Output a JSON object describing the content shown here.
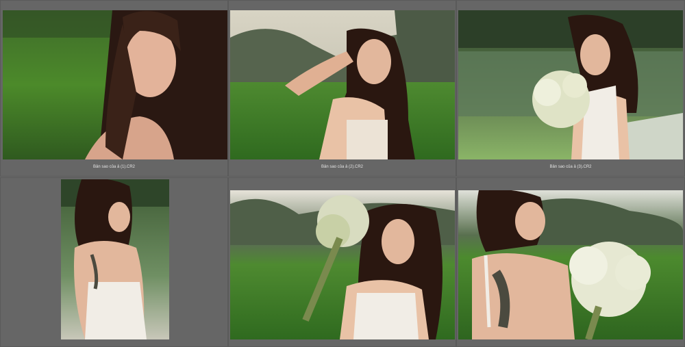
{
  "grid": {
    "captions": [
      "Bản sao của ả (1).CR2",
      "Bản sao của ả (2).CR2",
      "Bản sao của ả (3).CR2"
    ],
    "thumbnails": [
      {
        "subject": "woman portrait close-up, green field background"
      },
      {
        "subject": "woman touching hair, field and hills"
      },
      {
        "subject": "woman holding white flower bouquet by lake"
      },
      {
        "subject": "woman in white halter dress, back view, lake"
      },
      {
        "subject": "woman holding dried flower bouquet, field"
      },
      {
        "subject": "woman with back tattoo holding flowers, field"
      }
    ]
  }
}
